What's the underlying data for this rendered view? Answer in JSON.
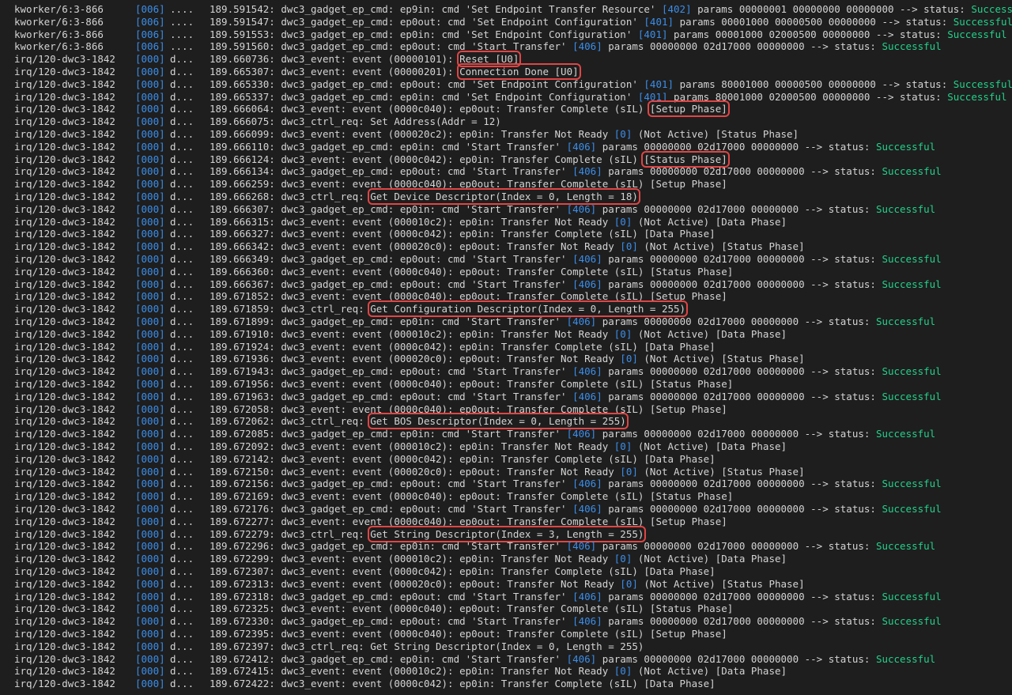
{
  "lines": [
    {
      "proc": "kworker/6:3-866",
      "cpu": "[006]",
      "flags": "....",
      "ts": "189.591542:",
      "msg": "dwc3_gadget_ep_cmd: ep9in: cmd 'Set Endpoint Transfer Resource'",
      "n": "[402]",
      "tail": "params 00000001 00000000 00000000 --> status:",
      "status": "Successful"
    },
    {
      "proc": "kworker/6:3-866",
      "cpu": "[006]",
      "flags": "....",
      "ts": "189.591547:",
      "msg": "dwc3_gadget_ep_cmd: ep0out: cmd 'Set Endpoint Configuration'",
      "n": "[401]",
      "tail": "params 00001000 00000500 00000000 --> status:",
      "status": "Successful"
    },
    {
      "proc": "kworker/6:3-866",
      "cpu": "[006]",
      "flags": "....",
      "ts": "189.591553:",
      "msg": "dwc3_gadget_ep_cmd: ep0in: cmd 'Set Endpoint Configuration'",
      "n": "[401]",
      "tail": "params 00001000 02000500 00000000 --> status:",
      "status": "Successful"
    },
    {
      "proc": "kworker/6:3-866",
      "cpu": "[006]",
      "flags": "....",
      "ts": "189.591560:",
      "msg": "dwc3_gadget_ep_cmd: ep0out: cmd 'Start Transfer'",
      "n": "[406]",
      "tail": "params 00000000 02d17000 00000000 --> status:",
      "status": "Successful"
    },
    {
      "proc": "irq/120-dwc3-1842",
      "cpu": "[000]",
      "flags": "d...",
      "ts": "189.660736:",
      "msg": "dwc3_event: event (00000101): ",
      "hl": "Reset [U0]"
    },
    {
      "proc": "irq/120-dwc3-1842",
      "cpu": "[000]",
      "flags": "d...",
      "ts": "189.665307:",
      "msg": "dwc3_event: event (00000201): ",
      "hl": "Connection Done [U0]"
    },
    {
      "proc": "irq/120-dwc3-1842",
      "cpu": "[000]",
      "flags": "d...",
      "ts": "189.665330:",
      "msg": "dwc3_gadget_ep_cmd: ep0out: cmd 'Set Endpoint Configuration'",
      "n": "[401]",
      "tail": "params 80001000 00000500 00000000 --> status:",
      "status": "Successful"
    },
    {
      "proc": "irq/120-dwc3-1842",
      "cpu": "[000]",
      "flags": "d...",
      "ts": "189.665337:",
      "msg": "dwc3_gadget_ep_cmd: ep0in: cmd 'Set Endpoint Configuration'",
      "n": "[401]",
      "tail": "params 80001000 02000500 00000000 --> status:",
      "status": "Successful"
    },
    {
      "proc": "irq/120-dwc3-1842",
      "cpu": "[000]",
      "flags": "d...",
      "ts": "189.666064:",
      "msg": "dwc3_event: event (0000c040): ep0out: Transfer Complete (sIL) ",
      "hl": "[Setup Phase]"
    },
    {
      "proc": "irq/120-dwc3-1842",
      "cpu": "[000]",
      "flags": "d...",
      "ts": "189.666075:",
      "msg": "dwc3_ctrl_req: Set Address(Addr = 12)"
    },
    {
      "proc": "irq/120-dwc3-1842",
      "cpu": "[000]",
      "flags": "d...",
      "ts": "189.666099:",
      "msg": "dwc3_event: event (000020c2): ep0in: Transfer Not Ready",
      "n": "[0]",
      "tail": "(Not Active) [Status Phase]"
    },
    {
      "proc": "irq/120-dwc3-1842",
      "cpu": "[000]",
      "flags": "d...",
      "ts": "189.666110:",
      "msg": "dwc3_gadget_ep_cmd: ep0in: cmd 'Start Transfer'",
      "n": "[406]",
      "tail": "params 00000000 02d17000 00000000 --> status:",
      "status": "Successful"
    },
    {
      "proc": "irq/120-dwc3-1842",
      "cpu": "[000]",
      "flags": "d...",
      "ts": "189.666124:",
      "msg": "dwc3_event: event (0000c042): ep0in: Transfer Complete (sIL) ",
      "hl": "[Status Phase]"
    },
    {
      "proc": "irq/120-dwc3-1842",
      "cpu": "[000]",
      "flags": "d...",
      "ts": "189.666134:",
      "msg": "dwc3_gadget_ep_cmd: ep0out: cmd 'Start Transfer'",
      "n": "[406]",
      "tail": "params 00000000 02d17000 00000000 --> status:",
      "status": "Successful"
    },
    {
      "proc": "irq/120-dwc3-1842",
      "cpu": "[000]",
      "flags": "d...",
      "ts": "189.666259:",
      "msg": "dwc3_event: event (0000c040): ep0out: Transfer Complete (sIL) [Setup Phase]"
    },
    {
      "proc": "irq/120-dwc3-1842",
      "cpu": "[000]",
      "flags": "d...",
      "ts": "189.666268:",
      "msg": "dwc3_ctrl_req: ",
      "hl": "Get Device Descriptor(Index = 0, Length = 18)"
    },
    {
      "proc": "irq/120-dwc3-1842",
      "cpu": "[000]",
      "flags": "d...",
      "ts": "189.666307:",
      "msg": "dwc3_gadget_ep_cmd: ep0in: cmd 'Start Transfer'",
      "n": "[406]",
      "tail": "params 00000000 02d17000 00000000 --> status:",
      "status": "Successful"
    },
    {
      "proc": "irq/120-dwc3-1842",
      "cpu": "[000]",
      "flags": "d...",
      "ts": "189.666315:",
      "msg": "dwc3_event: event (000010c2): ep0in: Transfer Not Ready",
      "n": "[0]",
      "tail": "(Not Active) [Data Phase]"
    },
    {
      "proc": "irq/120-dwc3-1842",
      "cpu": "[000]",
      "flags": "d...",
      "ts": "189.666327:",
      "msg": "dwc3_event: event (0000c042): ep0in: Transfer Complete (sIL) [Data Phase]"
    },
    {
      "proc": "irq/120-dwc3-1842",
      "cpu": "[000]",
      "flags": "d...",
      "ts": "189.666342:",
      "msg": "dwc3_event: event (000020c0): ep0out: Transfer Not Ready",
      "n": "[0]",
      "tail": "(Not Active) [Status Phase]"
    },
    {
      "proc": "irq/120-dwc3-1842",
      "cpu": "[000]",
      "flags": "d...",
      "ts": "189.666349:",
      "msg": "dwc3_gadget_ep_cmd: ep0out: cmd 'Start Transfer'",
      "n": "[406]",
      "tail": "params 00000000 02d17000 00000000 --> status:",
      "status": "Successful"
    },
    {
      "proc": "irq/120-dwc3-1842",
      "cpu": "[000]",
      "flags": "d...",
      "ts": "189.666360:",
      "msg": "dwc3_event: event (0000c040): ep0out: Transfer Complete (sIL) [Status Phase]"
    },
    {
      "proc": "irq/120-dwc3-1842",
      "cpu": "[000]",
      "flags": "d...",
      "ts": "189.666367:",
      "msg": "dwc3_gadget_ep_cmd: ep0out: cmd 'Start Transfer'",
      "n": "[406]",
      "tail": "params 00000000 02d17000 00000000 --> status:",
      "status": "Successful"
    },
    {
      "proc": "irq/120-dwc3-1842",
      "cpu": "[000]",
      "flags": "d...",
      "ts": "189.671852:",
      "msg": "dwc3_event: event (0000c040): ep0out: Transfer Complete (sIL) [Setup Phase]"
    },
    {
      "proc": "irq/120-dwc3-1842",
      "cpu": "[000]",
      "flags": "d...",
      "ts": "189.671859:",
      "msg": "dwc3_ctrl_req: ",
      "hl": "Get Configuration Descriptor(Index = 0, Length = 255)"
    },
    {
      "proc": "irq/120-dwc3-1842",
      "cpu": "[000]",
      "flags": "d...",
      "ts": "189.671899:",
      "msg": "dwc3_gadget_ep_cmd: ep0in: cmd 'Start Transfer'",
      "n": "[406]",
      "tail": "params 00000000 02d17000 00000000 --> status:",
      "status": "Successful"
    },
    {
      "proc": "irq/120-dwc3-1842",
      "cpu": "[000]",
      "flags": "d...",
      "ts": "189.671910:",
      "msg": "dwc3_event: event (000010c2): ep0in: Transfer Not Ready",
      "n": "[0]",
      "tail": "(Not Active) [Data Phase]"
    },
    {
      "proc": "irq/120-dwc3-1842",
      "cpu": "[000]",
      "flags": "d...",
      "ts": "189.671924:",
      "msg": "dwc3_event: event (0000c042): ep0in: Transfer Complete (sIL) [Data Phase]"
    },
    {
      "proc": "irq/120-dwc3-1842",
      "cpu": "[000]",
      "flags": "d...",
      "ts": "189.671936:",
      "msg": "dwc3_event: event (000020c0): ep0out: Transfer Not Ready",
      "n": "[0]",
      "tail": "(Not Active) [Status Phase]"
    },
    {
      "proc": "irq/120-dwc3-1842",
      "cpu": "[000]",
      "flags": "d...",
      "ts": "189.671943:",
      "msg": "dwc3_gadget_ep_cmd: ep0out: cmd 'Start Transfer'",
      "n": "[406]",
      "tail": "params 00000000 02d17000 00000000 --> status:",
      "status": "Successful"
    },
    {
      "proc": "irq/120-dwc3-1842",
      "cpu": "[000]",
      "flags": "d...",
      "ts": "189.671956:",
      "msg": "dwc3_event: event (0000c040): ep0out: Transfer Complete (sIL) [Status Phase]"
    },
    {
      "proc": "irq/120-dwc3-1842",
      "cpu": "[000]",
      "flags": "d...",
      "ts": "189.671963:",
      "msg": "dwc3_gadget_ep_cmd: ep0out: cmd 'Start Transfer'",
      "n": "[406]",
      "tail": "params 00000000 02d17000 00000000 --> status:",
      "status": "Successful"
    },
    {
      "proc": "irq/120-dwc3-1842",
      "cpu": "[000]",
      "flags": "d...",
      "ts": "189.672058:",
      "msg": "dwc3_event: event (0000c040): ep0out: Transfer Complete (sIL) [Setup Phase]"
    },
    {
      "proc": "irq/120-dwc3-1842",
      "cpu": "[000]",
      "flags": "d...",
      "ts": "189.672062:",
      "msg": "dwc3_ctrl_req: ",
      "hl": "Get BOS Descriptor(Index = 0, Length = 255)"
    },
    {
      "proc": "irq/120-dwc3-1842",
      "cpu": "[000]",
      "flags": "d...",
      "ts": "189.672085:",
      "msg": "dwc3_gadget_ep_cmd: ep0in: cmd 'Start Transfer'",
      "n": "[406]",
      "tail": "params 00000000 02d17000 00000000 --> status:",
      "status": "Successful"
    },
    {
      "proc": "irq/120-dwc3-1842",
      "cpu": "[000]",
      "flags": "d...",
      "ts": "189.672092:",
      "msg": "dwc3_event: event (000010c2): ep0in: Transfer Not Ready",
      "n": "[0]",
      "tail": "(Not Active) [Data Phase]"
    },
    {
      "proc": "irq/120-dwc3-1842",
      "cpu": "[000]",
      "flags": "d...",
      "ts": "189.672142:",
      "msg": "dwc3_event: event (0000c042): ep0in: Transfer Complete (sIL) [Data Phase]"
    },
    {
      "proc": "irq/120-dwc3-1842",
      "cpu": "[000]",
      "flags": "d...",
      "ts": "189.672150:",
      "msg": "dwc3_event: event (000020c0): ep0out: Transfer Not Ready",
      "n": "[0]",
      "tail": "(Not Active) [Status Phase]"
    },
    {
      "proc": "irq/120-dwc3-1842",
      "cpu": "[000]",
      "flags": "d...",
      "ts": "189.672156:",
      "msg": "dwc3_gadget_ep_cmd: ep0out: cmd 'Start Transfer'",
      "n": "[406]",
      "tail": "params 00000000 02d17000 00000000 --> status:",
      "status": "Successful"
    },
    {
      "proc": "irq/120-dwc3-1842",
      "cpu": "[000]",
      "flags": "d...",
      "ts": "189.672169:",
      "msg": "dwc3_event: event (0000c040): ep0out: Transfer Complete (sIL) [Status Phase]"
    },
    {
      "proc": "irq/120-dwc3-1842",
      "cpu": "[000]",
      "flags": "d...",
      "ts": "189.672176:",
      "msg": "dwc3_gadget_ep_cmd: ep0out: cmd 'Start Transfer'",
      "n": "[406]",
      "tail": "params 00000000 02d17000 00000000 --> status:",
      "status": "Successful"
    },
    {
      "proc": "irq/120-dwc3-1842",
      "cpu": "[000]",
      "flags": "d...",
      "ts": "189.672277:",
      "msg": "dwc3_event: event (0000c040): ep0out: Transfer Complete (sIL) [Setup Phase]"
    },
    {
      "proc": "irq/120-dwc3-1842",
      "cpu": "[000]",
      "flags": "d...",
      "ts": "189.672279:",
      "msg": "dwc3_ctrl_req: ",
      "hl": "Get String Descriptor(Index = 3, Length = 255)"
    },
    {
      "proc": "irq/120-dwc3-1842",
      "cpu": "[000]",
      "flags": "d...",
      "ts": "189.672296:",
      "msg": "dwc3_gadget_ep_cmd: ep0in: cmd 'Start Transfer'",
      "n": "[406]",
      "tail": "params 00000000 02d17000 00000000 --> status:",
      "status": "Successful"
    },
    {
      "proc": "irq/120-dwc3-1842",
      "cpu": "[000]",
      "flags": "d...",
      "ts": "189.672299:",
      "msg": "dwc3_event: event (000010c2): ep0in: Transfer Not Ready",
      "n": "[0]",
      "tail": "(Not Active) [Data Phase]"
    },
    {
      "proc": "irq/120-dwc3-1842",
      "cpu": "[000]",
      "flags": "d...",
      "ts": "189.672307:",
      "msg": "dwc3_event: event (0000c042): ep0in: Transfer Complete (sIL) [Data Phase]"
    },
    {
      "proc": "irq/120-dwc3-1842",
      "cpu": "[000]",
      "flags": "d...",
      "ts": "189.672313:",
      "msg": "dwc3_event: event (000020c0): ep0out: Transfer Not Ready",
      "n": "[0]",
      "tail": "(Not Active) [Status Phase]"
    },
    {
      "proc": "irq/120-dwc3-1842",
      "cpu": "[000]",
      "flags": "d...",
      "ts": "189.672318:",
      "msg": "dwc3_gadget_ep_cmd: ep0out: cmd 'Start Transfer'",
      "n": "[406]",
      "tail": "params 00000000 02d17000 00000000 --> status:",
      "status": "Successful"
    },
    {
      "proc": "irq/120-dwc3-1842",
      "cpu": "[000]",
      "flags": "d...",
      "ts": "189.672325:",
      "msg": "dwc3_event: event (0000c040): ep0out: Transfer Complete (sIL) [Status Phase]"
    },
    {
      "proc": "irq/120-dwc3-1842",
      "cpu": "[000]",
      "flags": "d...",
      "ts": "189.672330:",
      "msg": "dwc3_gadget_ep_cmd: ep0out: cmd 'Start Transfer'",
      "n": "[406]",
      "tail": "params 00000000 02d17000 00000000 --> status:",
      "status": "Successful"
    },
    {
      "proc": "irq/120-dwc3-1842",
      "cpu": "[000]",
      "flags": "d...",
      "ts": "189.672395:",
      "msg": "dwc3_event: event (0000c040): ep0out: Transfer Complete (sIL) [Setup Phase]"
    },
    {
      "proc": "irq/120-dwc3-1842",
      "cpu": "[000]",
      "flags": "d...",
      "ts": "189.672397:",
      "msg": "dwc3_ctrl_req: Get String Descriptor(Index = 0, Length = 255)"
    },
    {
      "proc": "irq/120-dwc3-1842",
      "cpu": "[000]",
      "flags": "d...",
      "ts": "189.672412:",
      "msg": "dwc3_gadget_ep_cmd: ep0in: cmd 'Start Transfer'",
      "n": "[406]",
      "tail": "params 00000000 02d17000 00000000 --> status:",
      "status": "Successful"
    },
    {
      "proc": "irq/120-dwc3-1842",
      "cpu": "[000]",
      "flags": "d...",
      "ts": "189.672415:",
      "msg": "dwc3_event: event (000010c2): ep0in: Transfer Not Ready",
      "n": "[0]",
      "tail": "(Not Active) [Data Phase]"
    },
    {
      "proc": "irq/120-dwc3-1842",
      "cpu": "[000]",
      "flags": "d...",
      "ts": "189.672422:",
      "msg": "dwc3_event: event (0000c042): ep0in: Transfer Complete (sIL) [Data Phase]"
    }
  ],
  "colors": {
    "background": "#1e1e1e",
    "text": "#d4d4d4",
    "number": "#3b8eea",
    "success": "#23d18b",
    "highlight_box": "#e04545"
  }
}
